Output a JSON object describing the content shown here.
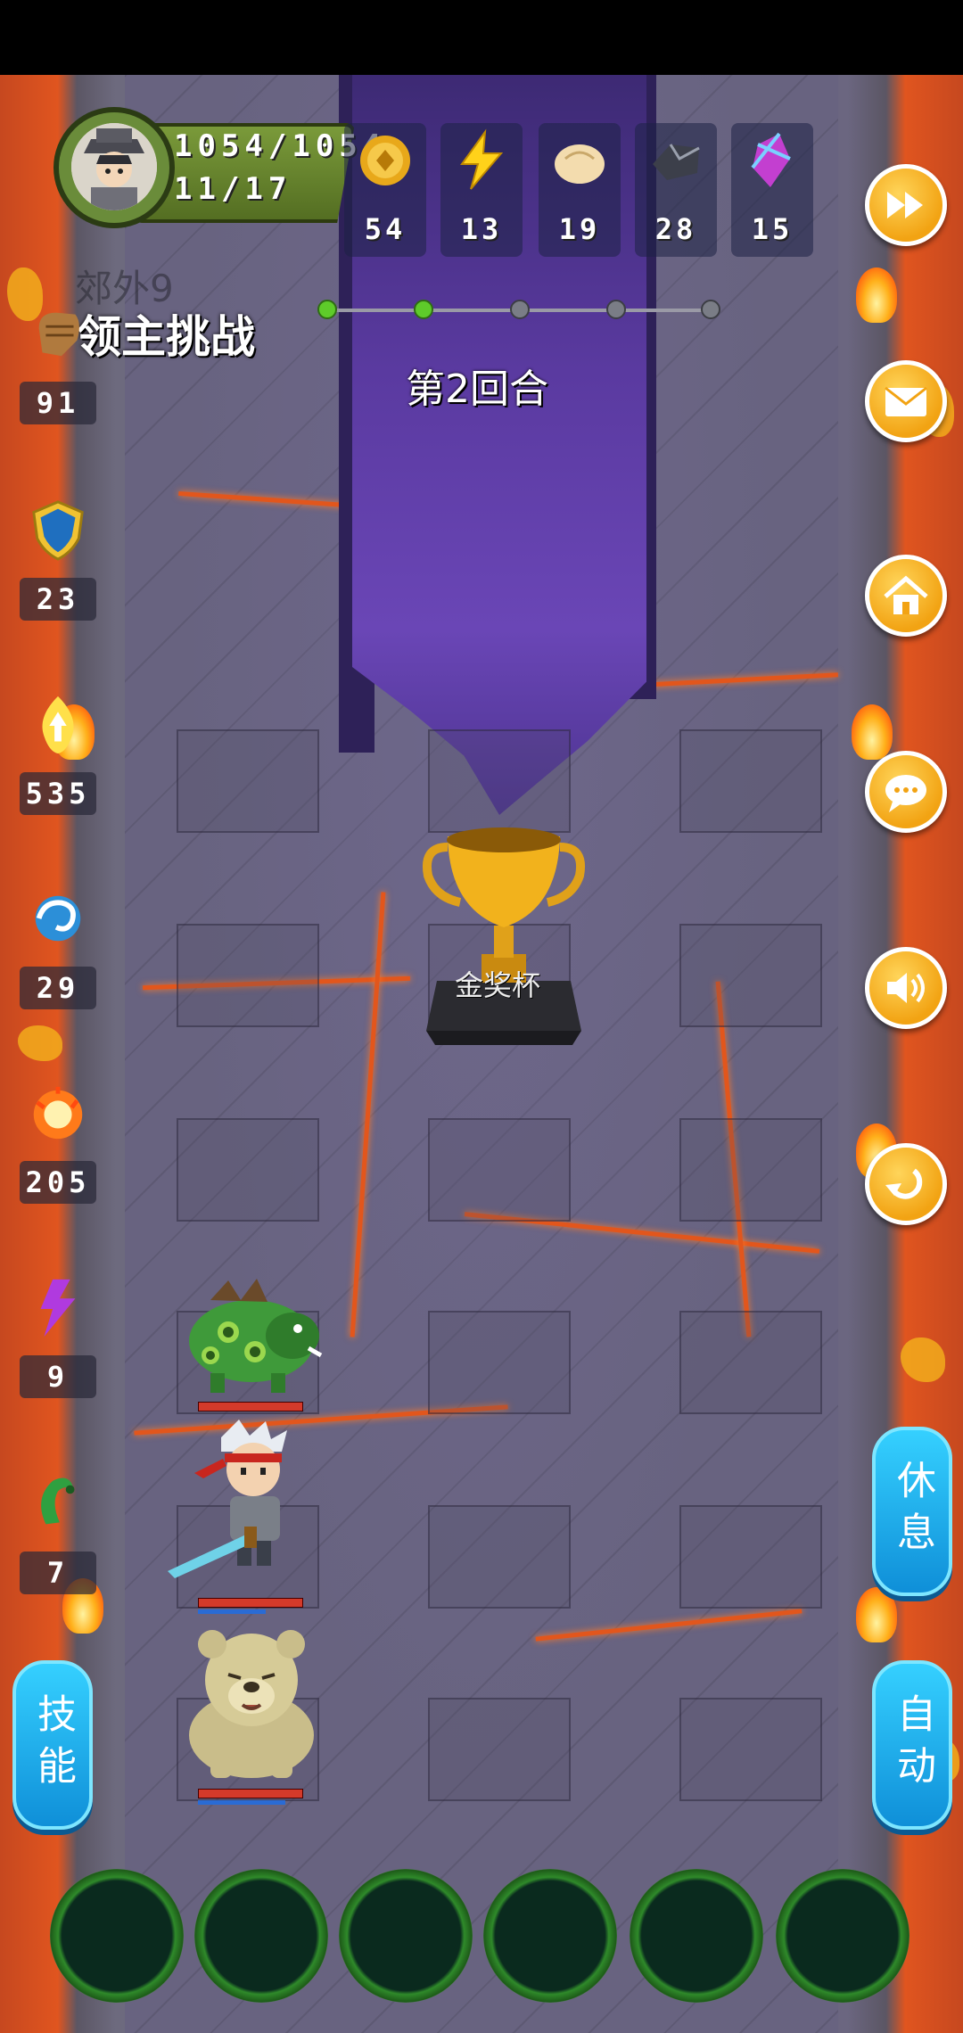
{
  "player": {
    "hp": "1054/1054",
    "level_progress": "11/17"
  },
  "resources": [
    {
      "icon": "gold-coin-icon",
      "value": "54"
    },
    {
      "icon": "lightning-icon",
      "value": "13"
    },
    {
      "icon": "bun-icon",
      "value": "19"
    },
    {
      "icon": "iron-ore-icon",
      "value": "28"
    },
    {
      "icon": "crystal-icon",
      "value": "15"
    }
  ],
  "area_name": "郊外9",
  "mode_title": "领主挑战",
  "round_label": "第2回合",
  "round_progress": {
    "total": 5,
    "completed": 2
  },
  "stats": [
    {
      "icon": "fist-icon",
      "value": "91"
    },
    {
      "icon": "shield-icon",
      "value": "23"
    },
    {
      "icon": "flame-power-icon",
      "value": "535"
    },
    {
      "icon": "swirl-icon",
      "value": "29"
    },
    {
      "icon": "fireball-icon",
      "value": "205"
    },
    {
      "icon": "purple-lightning-icon",
      "value": "9"
    },
    {
      "icon": "green-claw-icon",
      "value": "7"
    }
  ],
  "right_buttons": [
    "fast-forward-icon",
    "mail-icon",
    "home-icon",
    "chat-icon",
    "sound-icon",
    "return-icon"
  ],
  "buttons": {
    "rest": "休息",
    "auto": "自动",
    "skill": "技能"
  },
  "trophy_label": "金奖杯",
  "units": [
    {
      "name": "green-boar",
      "hp": 1.0
    },
    {
      "name": "hero-swordsman",
      "hp": 1.0,
      "mp": 0.65
    },
    {
      "name": "bear-pet",
      "hp": 1.0,
      "mp": 0.85
    }
  ],
  "skill_slots": 6,
  "colors": {
    "accent_orange": "#f2a313",
    "button_blue": "#1fa9ef",
    "lava": "#e2561c"
  }
}
